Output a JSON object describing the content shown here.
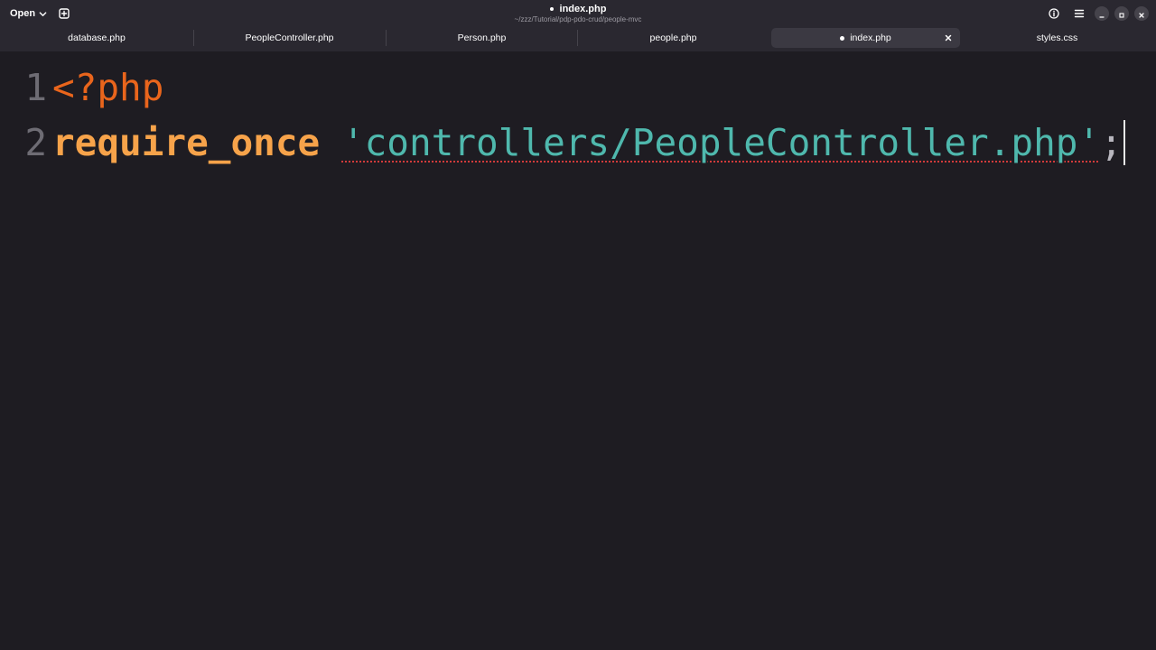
{
  "header": {
    "open_label": "Open",
    "title": "index.php",
    "subtitle": "~/zzz/Tutorial/pdp-pdo-crud/people-mvc",
    "icons": {
      "open_chevron": "chevron-down-icon",
      "new_tab": "new-tab-icon",
      "info": "info-icon",
      "menu": "hamburger-menu-icon",
      "minimize": "minimize-icon",
      "maximize": "maximize-icon",
      "close": "close-icon"
    }
  },
  "tabs": [
    {
      "label": "database.php",
      "active": false,
      "modified": false
    },
    {
      "label": "PeopleController.php",
      "active": false,
      "modified": false
    },
    {
      "label": "Person.php",
      "active": false,
      "modified": false
    },
    {
      "label": "people.php",
      "active": false,
      "modified": false
    },
    {
      "label": "index.php",
      "active": true,
      "modified": true
    },
    {
      "label": "styles.css",
      "active": false,
      "modified": false
    }
  ],
  "editor": {
    "lines": [
      {
        "number": "1",
        "tokens": [
          {
            "type": "php-open",
            "text": "<?php"
          }
        ]
      },
      {
        "number": "2",
        "tokens": [
          {
            "type": "keyword",
            "text": "require_once"
          },
          {
            "type": "space",
            "text": " "
          },
          {
            "type": "string",
            "text": "'controllers/PeopleController.php'"
          },
          {
            "type": "punct",
            "text": ";"
          }
        ]
      }
    ],
    "colors": {
      "background": "#1e1c22",
      "php_open": "#e9651c",
      "keyword": "#f7a34a",
      "string": "#4fb8ad",
      "spell_underline": "#d23a3a",
      "line_number": "#6e6c74"
    }
  }
}
